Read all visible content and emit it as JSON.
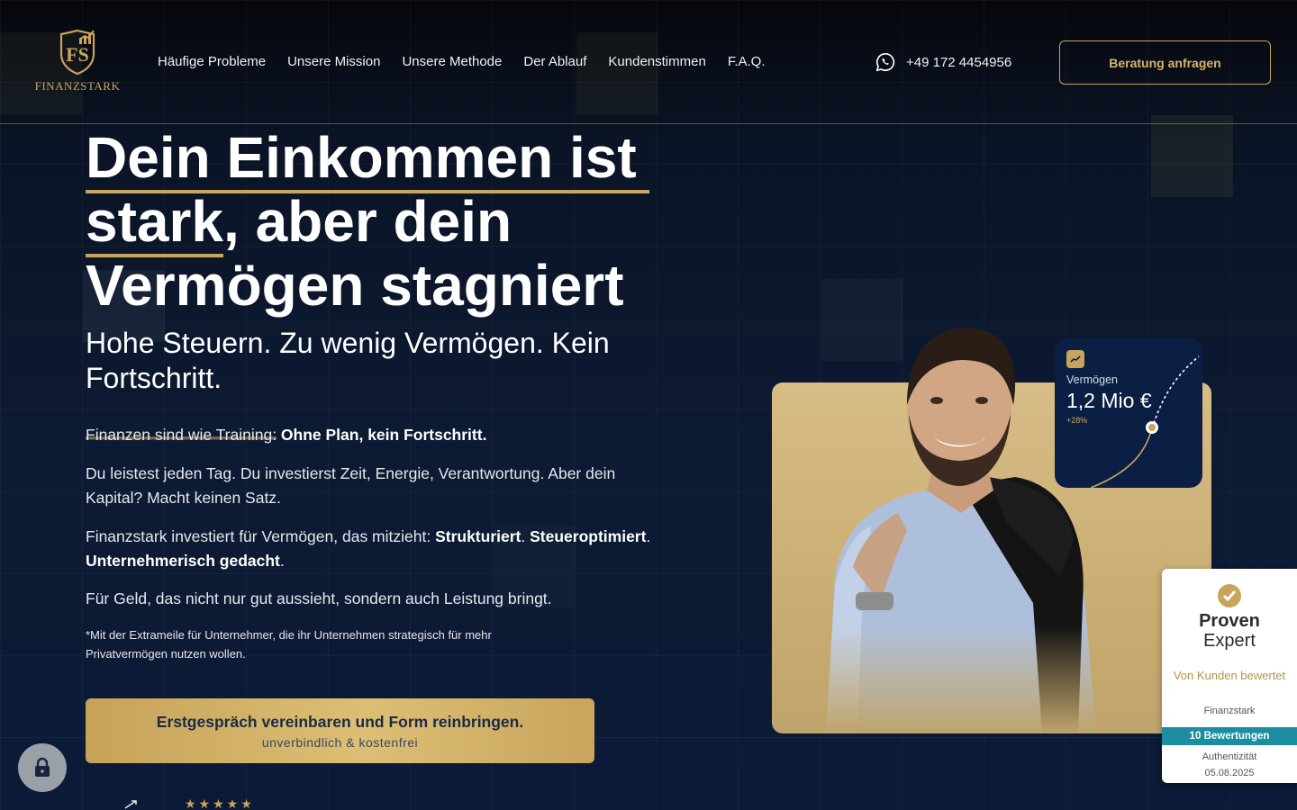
{
  "header": {
    "brand": "FINANZSTARK",
    "nav": [
      {
        "label": "Häufige Probleme"
      },
      {
        "label": "Unsere Mission"
      },
      {
        "label": "Unsere Methode"
      },
      {
        "label": "Der Ablauf"
      },
      {
        "label": "Kundenstimmen"
      },
      {
        "label": "F.A.Q."
      }
    ],
    "phone": "+49 172 4454956",
    "cta_label": "Beratung anfragen"
  },
  "hero": {
    "headline_part1": "Dein Einkommen ist",
    "headline_part2": "stark",
    "headline_part3": ", aber dein",
    "headline_part4": "Vermögen stagniert",
    "subheadline": "Hohe Steuern. Zu wenig Vermögen. Kein Fortschritt.",
    "p1_normal": "Finanzen sind wie Training:",
    "p1_bold": " Ohne Plan, kein Fortschritt.",
    "p2": "Du leistest jeden Tag. Du investierst Zeit, Energie, Verantwortung. Aber dein Kapital?  Macht keinen Satz.",
    "p3_normal": "Finanzstark investiert für Vermögen, das mitzieht: ",
    "p3_bold1": "Strukturiert",
    "p3_sep1": ". ",
    "p3_bold2": "Steueroptimiert",
    "p3_sep2": ". ",
    "p3_bold3": "Unternehmerisch gedacht",
    "p3_end": ".",
    "p4": "Für Geld, das nicht nur gut aussieht, sondern auch Leistung bringt.",
    "note": "*Mit der Extrameile für Unternehmer, die ihr Unternehmen strategisch für mehr Privatvermögen nutzen wollen.",
    "cta_line1": "Erstgespräch vereinbaren und Form reinbringen.",
    "cta_line2": "unverbindlich & kostenfrei",
    "stars": "★★★★★"
  },
  "widget": {
    "label": "Vermögen",
    "value": "1,2 Mio €",
    "change": "+28%"
  },
  "proven_expert": {
    "title1": "Proven",
    "title2": "Expert",
    "rated_by": "Von Kunden bewertet",
    "company": "Finanzstark",
    "reviews": "10 Bewertungen",
    "authenticity": "Authentizität",
    "date": "05.08.2025"
  },
  "icons": {
    "phone": "whatsapp-icon",
    "lock": "lock-icon",
    "check": "check-circle-icon",
    "widget": "trend-up-icon"
  },
  "colors": {
    "gold": "#c9a45c",
    "navy": "#0b1a36",
    "teal": "#1b8fa0"
  }
}
